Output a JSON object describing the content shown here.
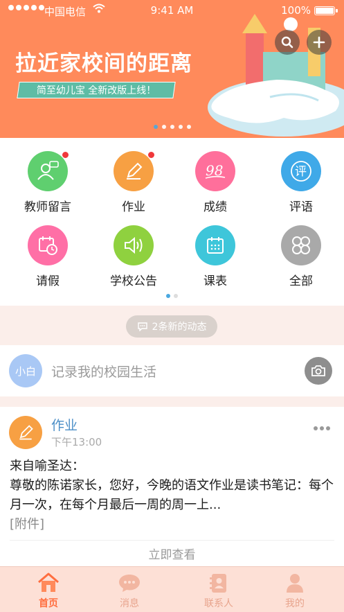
{
  "status_bar": {
    "carrier": "中国电信",
    "time": "9:41 AM",
    "battery": "100%"
  },
  "banner": {
    "title": "拉近家校间的距离",
    "subtitle": "简至幼儿宝  全新改版上线！",
    "dots_count": 5,
    "active_dot": 0,
    "search_icon": "search-icon",
    "add_icon": "plus-icon"
  },
  "features": [
    {
      "label": "教师留言",
      "icon": "teacher-icon",
      "color": "#5fcf6f",
      "badge": true
    },
    {
      "label": "作业",
      "icon": "pencil-icon",
      "color": "#f7a043",
      "badge": true
    },
    {
      "label": "成绩",
      "icon": "score-icon",
      "color": "#ff6f9b",
      "badge": false
    },
    {
      "label": "评语",
      "icon": "comment-icon",
      "color": "#3fa9e8",
      "badge": false
    },
    {
      "label": "请假",
      "icon": "calendar-clock-icon",
      "color": "#ff6fa6",
      "badge": false
    },
    {
      "label": "学校公告",
      "icon": "speaker-icon",
      "color": "#8fd13f",
      "badge": false
    },
    {
      "label": "课表",
      "icon": "schedule-icon",
      "color": "#3ec6da",
      "badge": false
    },
    {
      "label": "全部",
      "icon": "all-icon",
      "color": "#a9a9a9",
      "badge": false
    }
  ],
  "notice": {
    "text": "2条新的动态"
  },
  "compose": {
    "avatar_text": "小白",
    "placeholder": "记录我的校园生活"
  },
  "post": {
    "type": "作业",
    "time": "下午13:00",
    "body_line1": "来自喻圣达：",
    "body_line2": "尊敬的陈诺家长，您好，今晚的语文作业是读书笔记：每个月一次，在每个月最后一周的周一上...",
    "attachment": "[附件]",
    "view_label": "立即查看"
  },
  "tabs": [
    {
      "label": "首页",
      "icon": "home-icon",
      "active": true
    },
    {
      "label": "消息",
      "icon": "chat-icon",
      "active": false
    },
    {
      "label": "联系人",
      "icon": "contacts-icon",
      "active": false
    },
    {
      "label": "我的",
      "icon": "profile-icon",
      "active": false
    }
  ],
  "colors": {
    "banner": "#ff8a5b",
    "accent": "#ff6e3f",
    "link": "#4a8ec7",
    "badge": "#f0383b"
  }
}
